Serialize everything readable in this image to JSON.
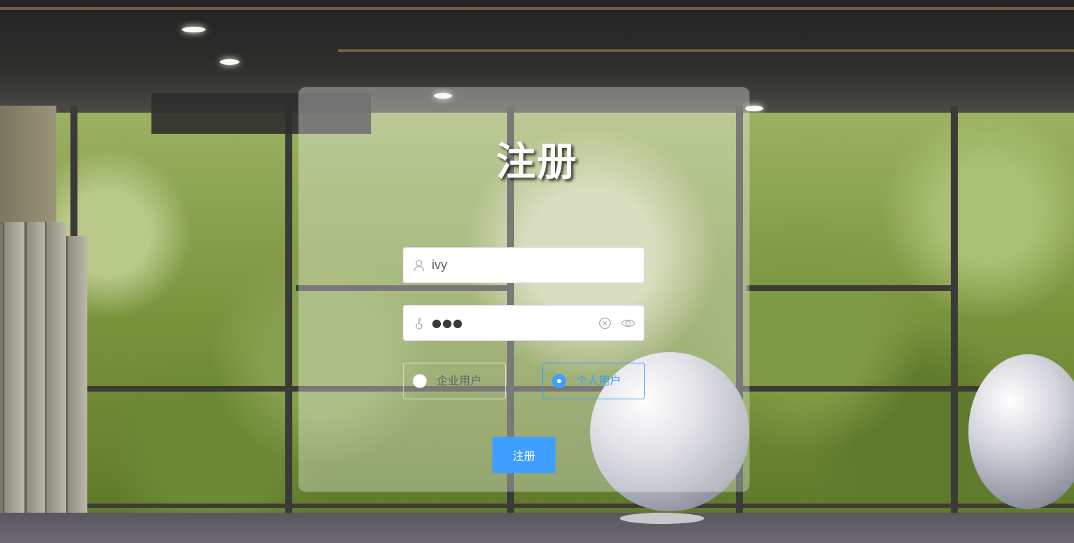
{
  "page": {
    "title": "注册"
  },
  "form": {
    "username": {
      "value": "ivy",
      "icon": "user-icon"
    },
    "password": {
      "masked_value": "●●●",
      "icon": "lock-icon",
      "clear_icon": "clear-icon",
      "reveal_icon": "eye-icon"
    },
    "user_type": {
      "options": [
        {
          "label": "企业用户",
          "checked": false
        },
        {
          "label": "个人用户",
          "checked": true
        }
      ]
    },
    "submit_label": "注册"
  },
  "colors": {
    "accent": "#409eff",
    "title": "#ffffff",
    "input_text": "#606266"
  }
}
